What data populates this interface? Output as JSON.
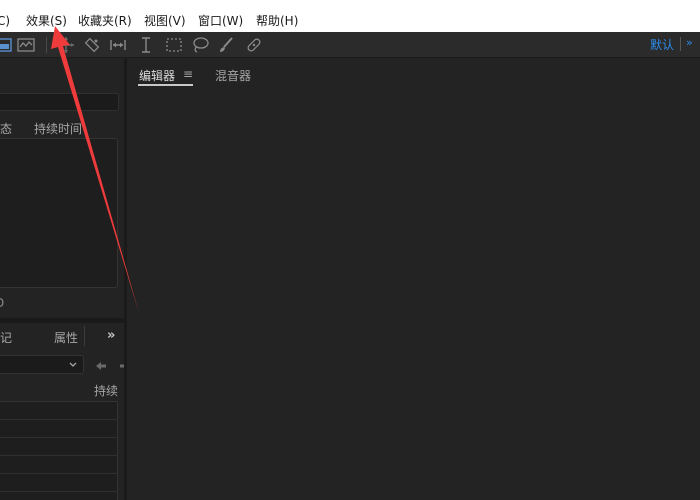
{
  "menubar": {
    "items": [
      "C)",
      "效果(S)",
      "收藏夹(R)",
      "视图(V)",
      "窗口(W)",
      "帮助(H)"
    ]
  },
  "toolbar": {
    "tools": [
      "spectral-view-icon",
      "waveform-view-icon",
      "move-tool-icon",
      "razor-tool-icon",
      "slip-tool-icon",
      "time-selection-icon",
      "marquee-icon",
      "lasso-icon",
      "brush-icon",
      "spot-healing-icon"
    ],
    "workspace_label": "默认",
    "workspace_more": "»"
  },
  "left_panel_top": {
    "col_status": "状态",
    "col_duration": "持续时间"
  },
  "left_panel_bottom": {
    "partial_char": "D",
    "tab_marker": "标记",
    "tab_properties": "属性",
    "expand": "»",
    "duration_header": "持续"
  },
  "main": {
    "tab_editor": "编辑器",
    "tab_menu": "≡",
    "tab_mixer": "混音器"
  },
  "colors": {
    "accent": "#2d8ceb",
    "annotation_arrow": "#ef3b3b",
    "panel_bg": "#232323",
    "toolbar_bg": "#2b2b2b"
  }
}
